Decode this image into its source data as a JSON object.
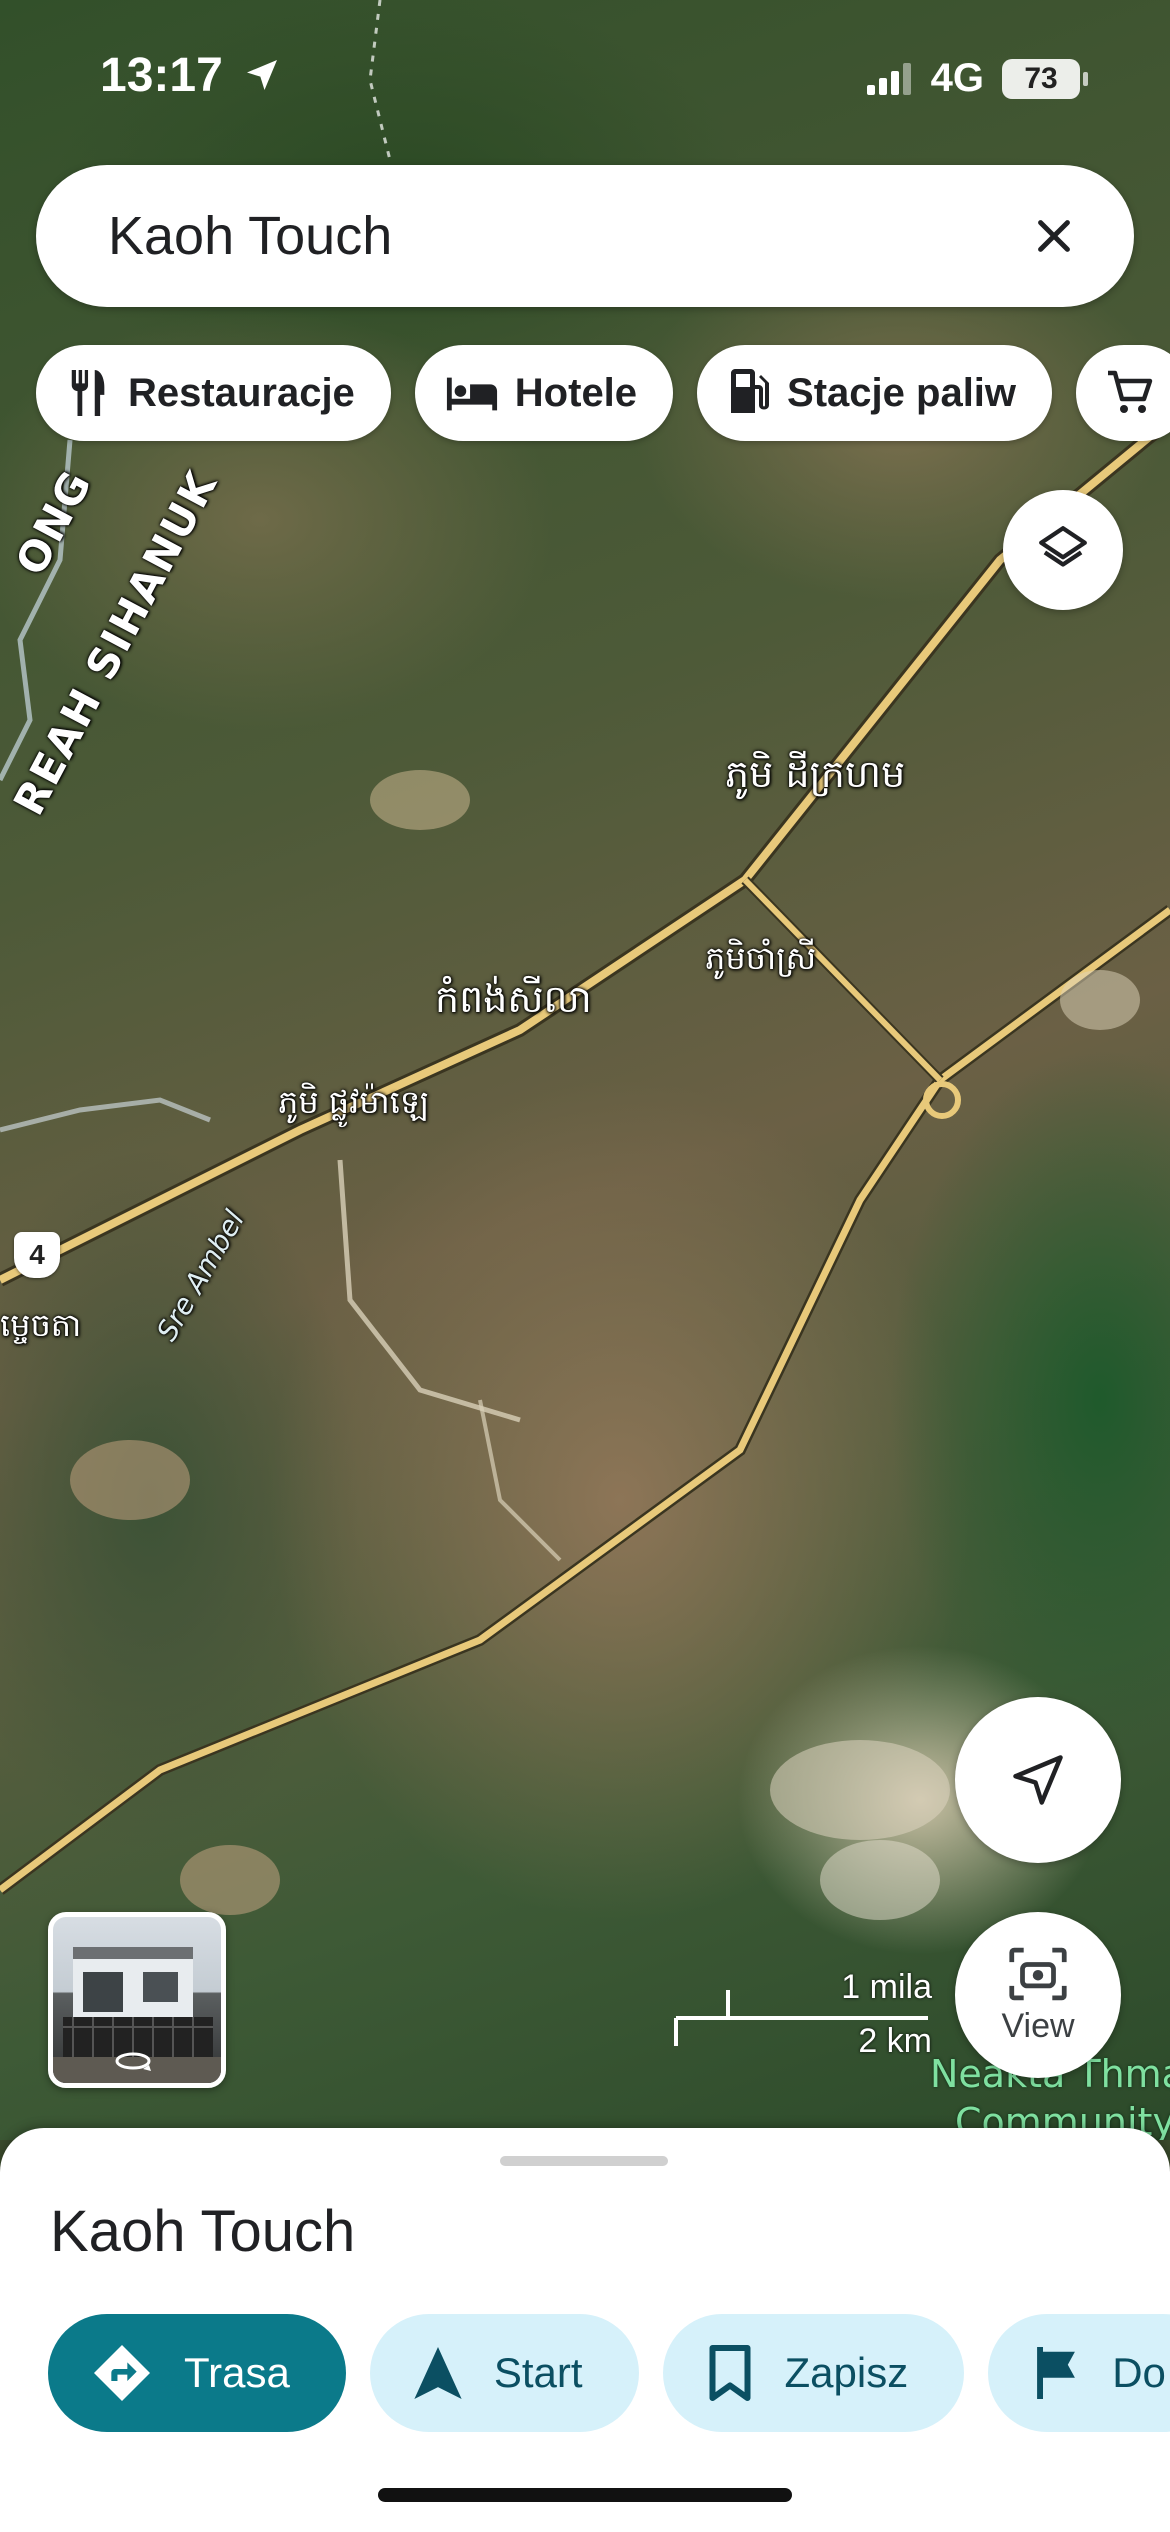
{
  "status_bar": {
    "time": "13:17",
    "network": "4G",
    "battery": "73"
  },
  "search": {
    "query": "Kaoh Touch"
  },
  "chips": [
    {
      "label": "Restauracje",
      "icon": "fork-knife-icon"
    },
    {
      "label": "Hotele",
      "icon": "bed-icon"
    },
    {
      "label": "Stacje paliw",
      "icon": "gas-station-icon"
    },
    {
      "label": "",
      "icon": "cart-icon"
    }
  ],
  "map": {
    "labels": {
      "area_top": "ONG",
      "area_left": "REAH SIHANUK",
      "village_1": "ភូមិ ដីក្រហម",
      "village_2": "ភូមិចាំស្រី",
      "village_3": "កំពង់សីលា",
      "village_4": "ភូមិ ផ្លូវម៉ាឡេ",
      "village_5": "ម្ចេចតា",
      "river": "Sre Ambel",
      "community": "Neakta Thma",
      "community_2": "Community"
    },
    "route_number": "4",
    "scale": {
      "miles": "1 mila",
      "km": "2 km"
    },
    "view_button": "View"
  },
  "place": {
    "title": "Kaoh Touch",
    "actions": [
      {
        "label": "Trasa",
        "icon": "directions-icon",
        "style": "primary"
      },
      {
        "label": "Start",
        "icon": "navigation-arrow-icon",
        "style": "secondary"
      },
      {
        "label": "Zapisz",
        "icon": "bookmark-icon",
        "style": "secondary"
      },
      {
        "label": "Do",
        "icon": "flag-icon",
        "style": "secondary"
      }
    ]
  },
  "colors": {
    "primary": "#0b7a8a",
    "secondary_bg": "#d6f1fa",
    "road": "#e8c97a"
  }
}
